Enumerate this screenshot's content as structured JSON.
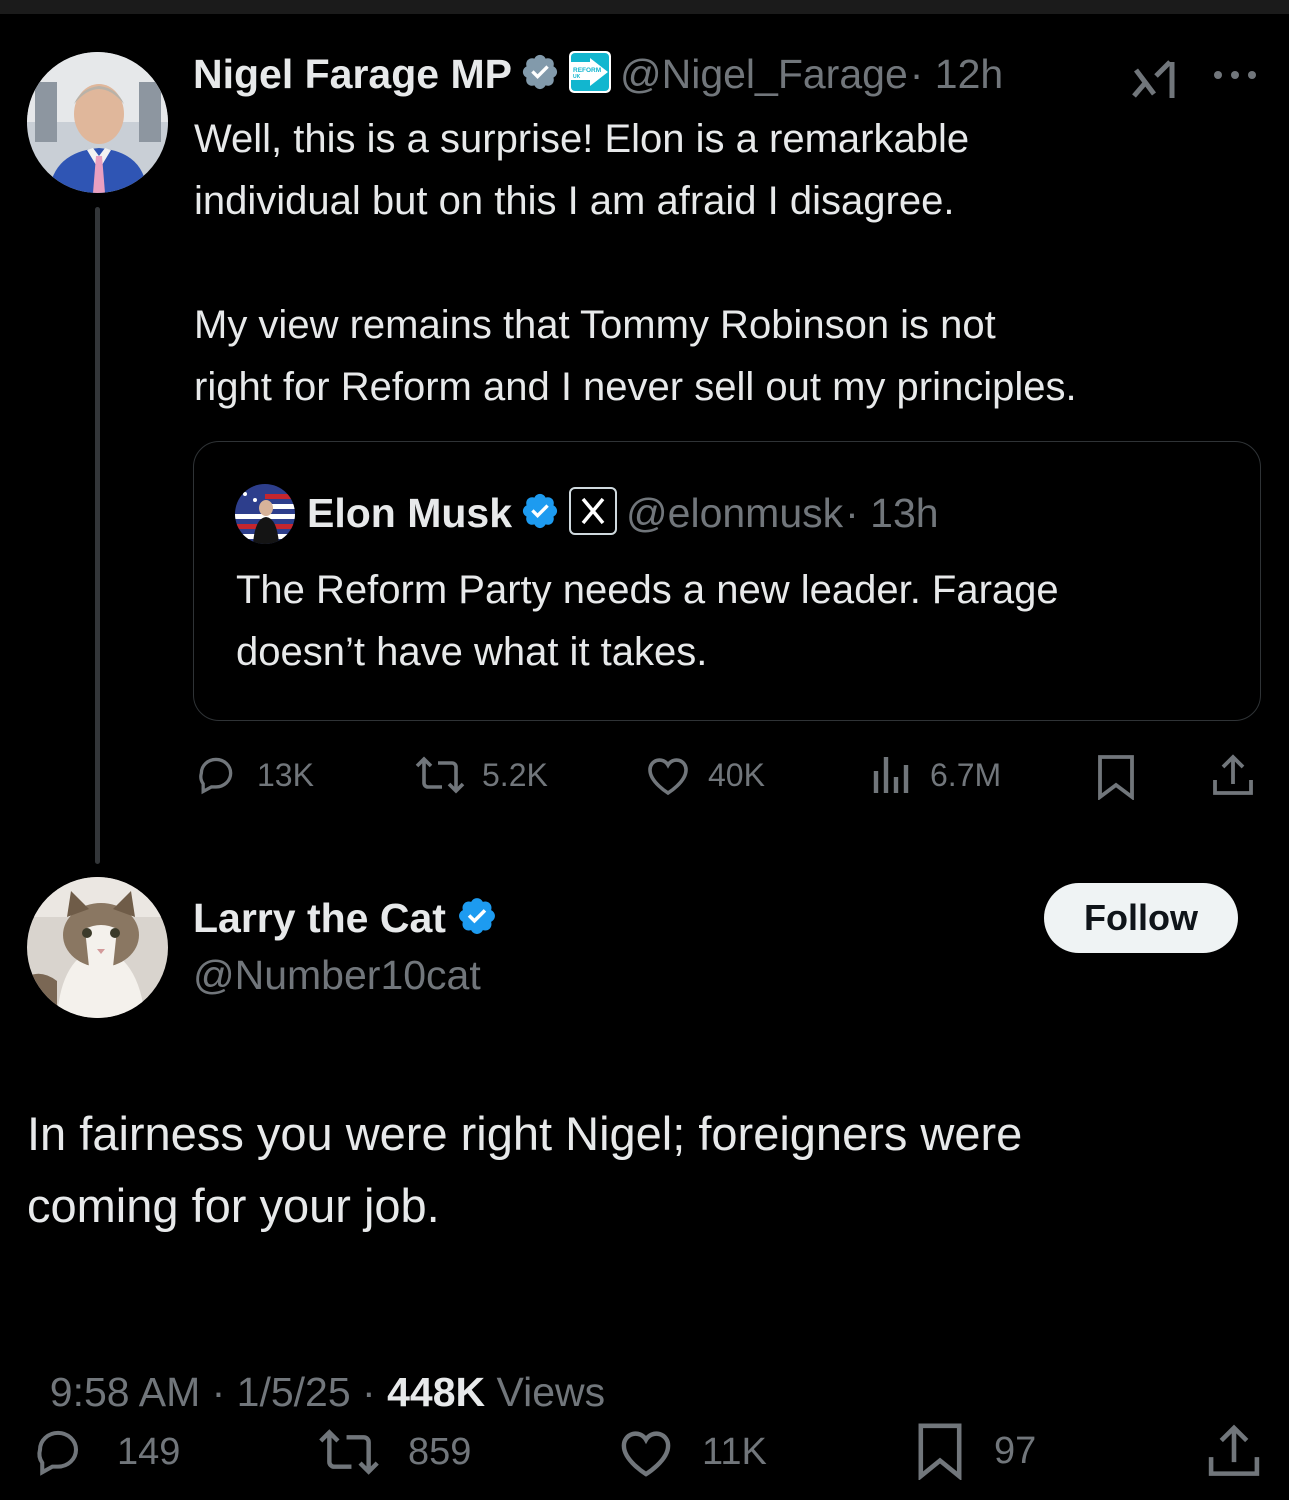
{
  "colors": {
    "accent": "#1d9bf0",
    "text": "#e7e9ea",
    "muted": "#71767b",
    "background": "#000000",
    "border": "#2f3336"
  },
  "parent_tweet": {
    "author_name": "Nigel Farage MP",
    "handle": "@Nigel_Farage",
    "time": "· 12h",
    "affiliation_badge": "REFORM UK",
    "text_line1": "Well, this is a surprise! Elon is a remarkable",
    "text_line2": "individual but on this I am afraid I disagree.",
    "text_line3": "My view remains that Tommy Robinson is not",
    "text_line4": "right for Reform and I never sell out my principles.",
    "quoted": {
      "author_name": "Elon Musk",
      "handle": "@elonmusk",
      "time": "· 13h",
      "text_line1": "The Reform Party needs a new leader. Farage",
      "text_line2": "doesn’t have what it takes."
    },
    "stats": {
      "replies": "13K",
      "reposts": "5.2K",
      "likes": "40K",
      "views": "6.7M"
    }
  },
  "reply_tweet": {
    "author_name": "Larry the Cat",
    "handle": "@Number10cat",
    "follow_label": "Follow",
    "text_line1": "In fairness you were right Nigel; foreigners were",
    "text_line2": "coming for your job.",
    "meta_time": "9:58 AM · 1/5/25 · ",
    "meta_views_count": "448K",
    "meta_views_label": " Views",
    "stats": {
      "replies": "149",
      "reposts": "859",
      "likes": "11K",
      "bookmarks": "97"
    }
  },
  "icons": [
    "verified-badge-icon",
    "reform-badge-icon",
    "grok-icon",
    "more-icon",
    "x-logo-icon",
    "reply-icon",
    "repost-icon",
    "like-icon",
    "views-icon",
    "bookmark-icon",
    "share-icon"
  ]
}
